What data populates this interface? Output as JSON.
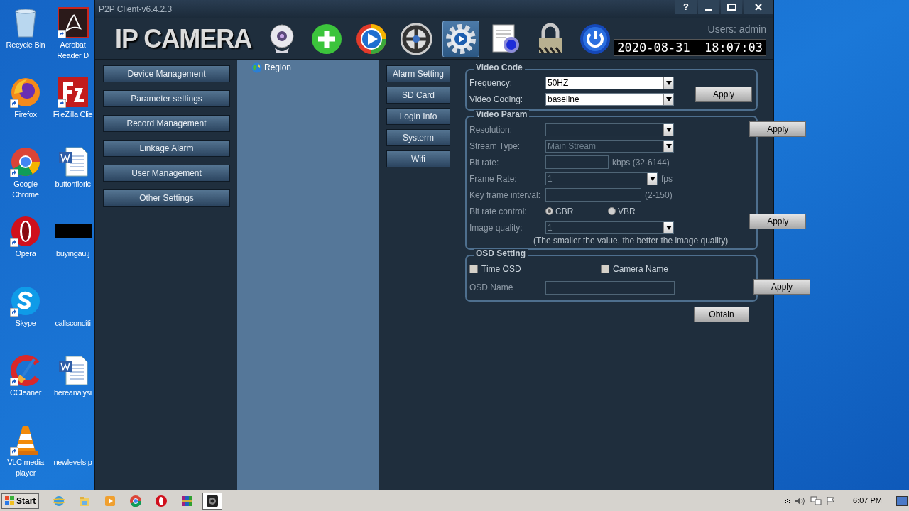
{
  "desktop_icons": [
    {
      "label": "Recycle Bin",
      "kind": "bin",
      "shortcut": false
    },
    {
      "label": "Acrobat\nReader D",
      "kind": "pdf",
      "shortcut": true
    },
    {
      "label": "Firefox",
      "kind": "firefox",
      "shortcut": true
    },
    {
      "label": "FileZilla Clie",
      "kind": "filezilla",
      "shortcut": true
    },
    {
      "label": "Google\nChrome",
      "kind": "chrome",
      "shortcut": true
    },
    {
      "label": "buttonfloric",
      "kind": "word",
      "shortcut": false
    },
    {
      "label": "Opera",
      "kind": "opera",
      "shortcut": true
    },
    {
      "label": "buyingau.j",
      "kind": "image",
      "shortcut": false
    },
    {
      "label": "Skype",
      "kind": "skype",
      "shortcut": true
    },
    {
      "label": "callsconditi",
      "kind": "blank",
      "shortcut": false
    },
    {
      "label": "CCleaner",
      "kind": "ccleaner",
      "shortcut": true
    },
    {
      "label": "hereanalysi",
      "kind": "word",
      "shortcut": false
    },
    {
      "label": "VLC media\nplayer",
      "kind": "vlc",
      "shortcut": true
    },
    {
      "label": "newlevels.p",
      "kind": "blank",
      "shortcut": false
    }
  ],
  "window": {
    "title": "P2P Client-v6.4.2.3",
    "controls": [
      "?"
    ],
    "logo": "IP CAMERA",
    "user": "Users: admin",
    "clock": "2020-08-31  18:07:03"
  },
  "toolbar": [
    {
      "kind": "webcam",
      "selected": false
    },
    {
      "kind": "add",
      "selected": false
    },
    {
      "kind": "play",
      "selected": false
    },
    {
      "kind": "reel",
      "selected": false
    },
    {
      "kind": "gear",
      "selected": true
    },
    {
      "kind": "document",
      "selected": false
    },
    {
      "kind": "lock",
      "selected": false
    },
    {
      "kind": "power",
      "selected": false
    }
  ],
  "menu": [
    "Device Management",
    "Parameter settings",
    "Record Management",
    "Linkage Alarm",
    "User Management",
    "Other Settings"
  ],
  "tree": [
    {
      "label": "Region"
    }
  ],
  "sub_menu": [
    "Alarm Setting",
    "SD Card",
    "Login Info",
    "Systerm",
    "Wifi"
  ],
  "video_code": {
    "title": "Video Code",
    "fields": [
      {
        "kind": "select",
        "label": "Frequency:",
        "value": "50HZ",
        "disabled": false
      },
      {
        "kind": "select",
        "label": "Video Coding:",
        "value": "baseline",
        "disabled": false
      }
    ],
    "buttons": [
      "Apply"
    ]
  },
  "video_param": {
    "title": "Video Param",
    "fields": [
      {
        "kind": "select",
        "label": "Resolution:",
        "disabled": true
      },
      {
        "kind": "select",
        "label": "Stream Type:",
        "value": "Main Stream",
        "disabled": true
      },
      {
        "kind": "input",
        "label": "Bit rate:",
        "suffix": "kbps (32-6144)",
        "disabled": true
      },
      {
        "kind": "select",
        "label": "Frame Rate:",
        "value": "1",
        "suffix": "fps",
        "disabled": true
      },
      {
        "kind": "input",
        "label": "Key frame interval:",
        "suffix": "(2-150)",
        "disabled": true
      },
      {
        "kind": "radio",
        "label": "Bit rate control:",
        "options": [
          {
            "label": "CBR",
            "selected": true
          },
          {
            "label": "VBR",
            "selected": false
          }
        ],
        "disabled": true
      },
      {
        "kind": "select",
        "label": "Image quality:",
        "value": "1",
        "disabled": true
      }
    ],
    "note": "(The smaller the value, the better the image quality)",
    "buttons": [
      "Apply",
      "Apply"
    ]
  },
  "osd": {
    "title": "OSD Setting",
    "checkboxes": [
      {
        "label": "Time OSD",
        "checked": false
      },
      {
        "label": "Camera Name",
        "checked": false
      }
    ],
    "name_label": "OSD Name",
    "buttons": [
      "Apply"
    ]
  },
  "obtain": "Obtain",
  "taskbar": {
    "start": "Start",
    "apps": [
      {
        "kind": "ie",
        "selected": false
      },
      {
        "kind": "folder",
        "selected": false
      },
      {
        "kind": "media",
        "selected": false
      },
      {
        "kind": "chrome",
        "selected": false
      },
      {
        "kind": "opera",
        "selected": false
      },
      {
        "kind": "rar",
        "selected": false
      },
      {
        "kind": "camera",
        "selected": true
      }
    ],
    "clock": "6:07 PM"
  }
}
